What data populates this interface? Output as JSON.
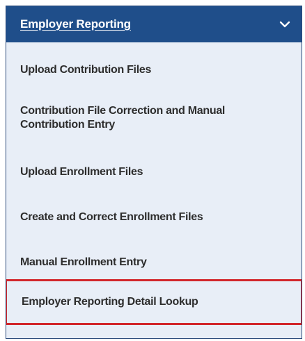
{
  "header": {
    "title": "Employer Reporting",
    "expand_icon": "chevron-down-icon"
  },
  "menu": {
    "items": [
      {
        "label": "Upload Contribution Files"
      },
      {
        "label": "Contribution File Correction and Manual Contribution Entry"
      },
      {
        "label": "Upload Enrollment Files"
      },
      {
        "label": "Create and Correct Enrollment Files"
      },
      {
        "label": "Manual Enrollment Entry"
      },
      {
        "label": "Employer Reporting Detail Lookup"
      }
    ],
    "selected_index": 5
  },
  "colors": {
    "header_bg": "#1f4e8a",
    "menu_bg": "#e8eef7",
    "highlight_border": "#d2262b",
    "item_text": "#2d2d2d"
  }
}
